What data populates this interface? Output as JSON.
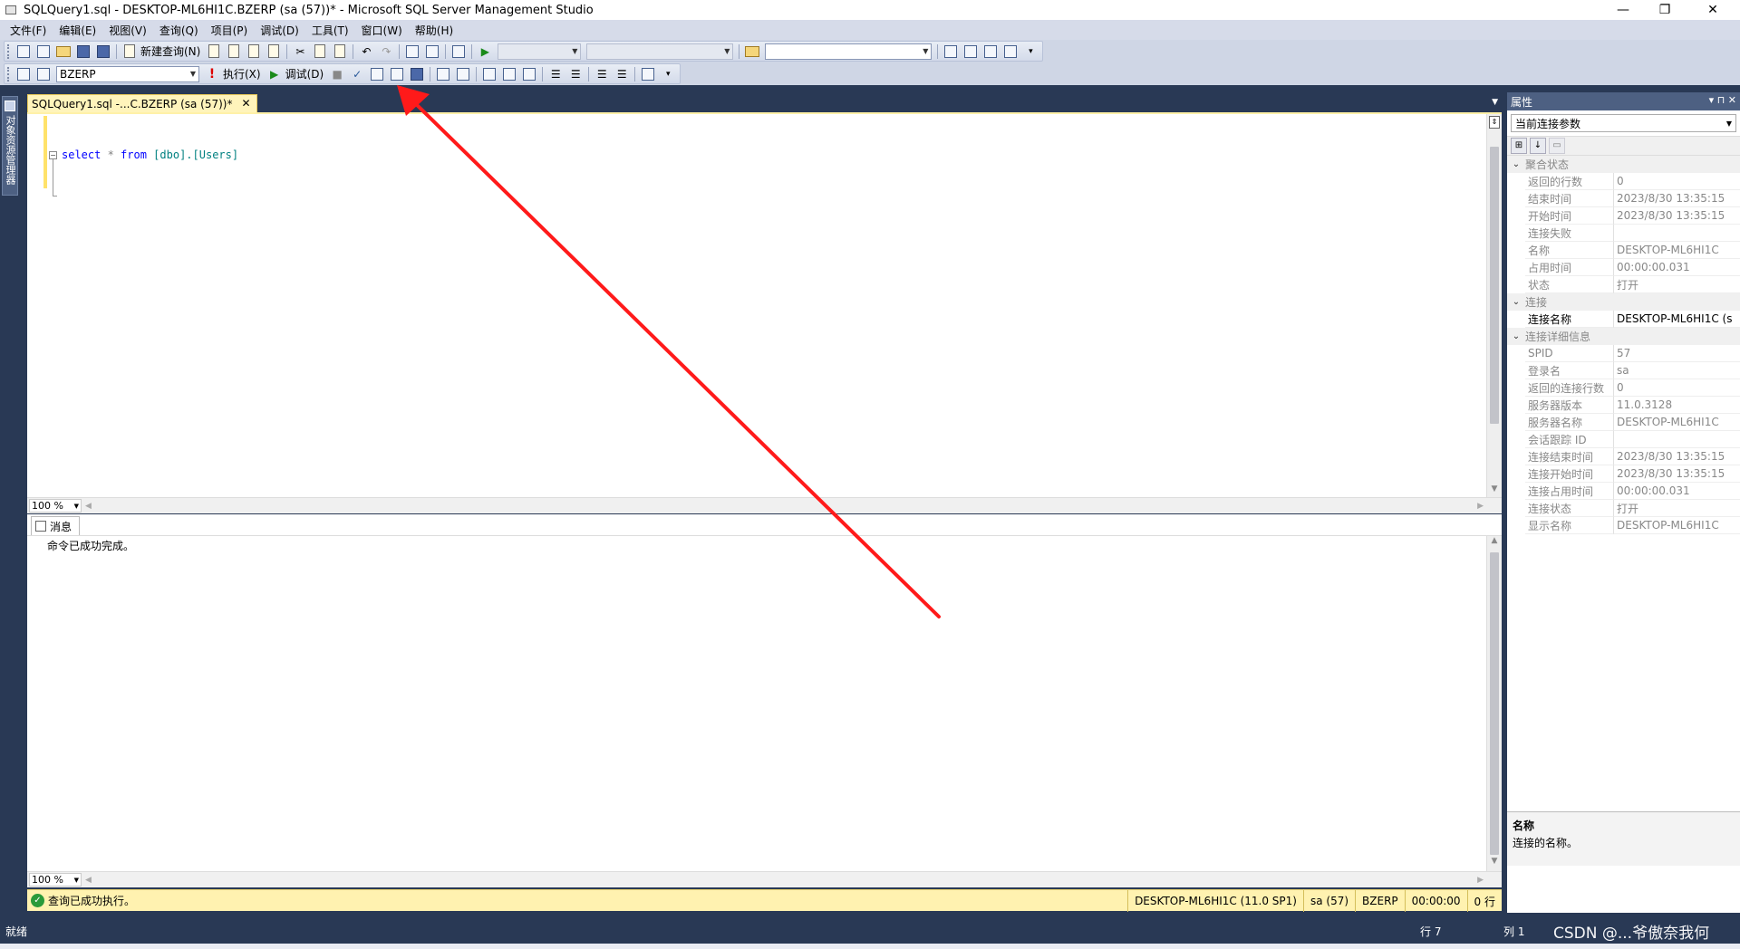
{
  "window": {
    "title": "SQLQuery1.sql - DESKTOP-ML6HI1C.BZERP (sa (57))* - Microsoft SQL Server Management Studio",
    "minimize": "—",
    "maximize": "❐",
    "close": "✕"
  },
  "menu": [
    "文件(F)",
    "编辑(E)",
    "视图(V)",
    "查询(Q)",
    "项目(P)",
    "调试(D)",
    "工具(T)",
    "窗口(W)",
    "帮助(H)"
  ],
  "toolbar1": {
    "new_query": "新建查询(N)"
  },
  "toolbar2": {
    "database": "BZERP",
    "execute": "执行(X)",
    "debug": "调试(D)"
  },
  "left_strip": {
    "object_explorer": "对象资源管理器"
  },
  "document_tab": {
    "label": "SQLQuery1.sql -...C.BZERP (sa (57))*",
    "close": "✕"
  },
  "editor": {
    "code_keyword_select": "select",
    "code_star": " * ",
    "code_keyword_from": "from",
    "code_object": " [dbo].[Users]",
    "zoom": "100 %"
  },
  "results": {
    "tab_label": "消息",
    "message": "命令已成功完成。",
    "zoom": "100 %"
  },
  "query_status": {
    "text": "查询已成功执行。",
    "server": "DESKTOP-ML6HI1C (11.0 SP1)",
    "user": "sa (57)",
    "database": "BZERP",
    "elapsed": "00:00:00",
    "rows": "0 行"
  },
  "properties": {
    "title": "属性",
    "header_controls": "▾ ⊓ ✕",
    "selected_object": "当前连接参数",
    "categories": [
      {
        "name": "聚合状态",
        "rows": [
          {
            "key": "返回的行数",
            "value": "0"
          },
          {
            "key": "结束时间",
            "value": "2023/8/30 13:35:15"
          },
          {
            "key": "开始时间",
            "value": "2023/8/30 13:35:15"
          },
          {
            "key": "连接失败",
            "value": ""
          },
          {
            "key": "名称",
            "value": "DESKTOP-ML6HI1C"
          },
          {
            "key": "占用时间",
            "value": "00:00:00.031"
          },
          {
            "key": "状态",
            "value": "打开"
          }
        ]
      },
      {
        "name": "连接",
        "rows": [
          {
            "key": "连接名称",
            "value": "DESKTOP-ML6HI1C (s"
          }
        ]
      },
      {
        "name": "连接详细信息",
        "rows": [
          {
            "key": "SPID",
            "value": "57"
          },
          {
            "key": "登录名",
            "value": "sa"
          },
          {
            "key": "返回的连接行数",
            "value": "0"
          },
          {
            "key": "服务器版本",
            "value": "11.0.3128"
          },
          {
            "key": "服务器名称",
            "value": "DESKTOP-ML6HI1C"
          },
          {
            "key": "会话跟踪 ID",
            "value": ""
          },
          {
            "key": "连接结束时间",
            "value": "2023/8/30 13:35:15"
          },
          {
            "key": "连接开始时间",
            "value": "2023/8/30 13:35:15"
          },
          {
            "key": "连接占用时间",
            "value": "00:00:00.031"
          },
          {
            "key": "连接状态",
            "value": "打开"
          },
          {
            "key": "显示名称",
            "value": "DESKTOP-ML6HI1C"
          }
        ]
      }
    ],
    "description_title": "名称",
    "description_text": "连接的名称。"
  },
  "status_bar": {
    "ready": "就绪",
    "line": "行 7",
    "column": "列 1",
    "watermark": "CSDN @...爷傲奈我何"
  },
  "colors": {
    "chrome_dark": "#293955",
    "toolbar": "#cfd6e5",
    "status_yellow": "#fff2b0",
    "annotation_red": "#ff1a1a"
  }
}
